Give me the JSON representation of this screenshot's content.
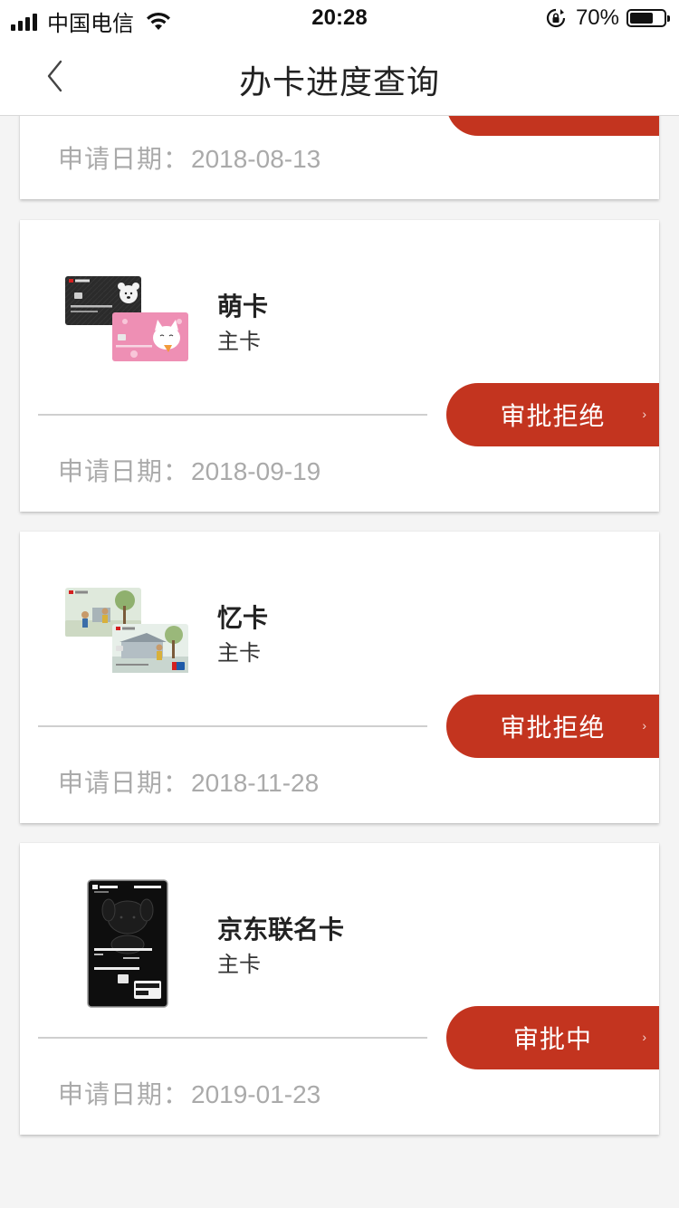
{
  "status_bar": {
    "carrier": "中国电信",
    "time": "20:28",
    "battery_percent": "70%",
    "battery_level": 0.7
  },
  "nav": {
    "title": "办卡进度查询",
    "back_icon": "chevron-left-icon"
  },
  "applications": [
    {
      "card_name": "",
      "card_type": "",
      "status": "",
      "date_label": "申请日期：",
      "date": "2018-08-13"
    },
    {
      "card_name": "萌卡",
      "card_type": "主卡",
      "status": "审批拒绝",
      "date_label": "申请日期：",
      "date": "2018-09-19"
    },
    {
      "card_name": "忆卡",
      "card_type": "主卡",
      "status": "审批拒绝",
      "date_label": "申请日期：",
      "date": "2018-11-28"
    },
    {
      "card_name": "京东联名卡",
      "card_type": "主卡",
      "status": "审批中",
      "date_label": "申请日期：",
      "date": "2019-01-23"
    }
  ],
  "colors": {
    "accent": "#c3341f",
    "background": "#f4f4f4",
    "date_text": "#aaaaaa"
  }
}
